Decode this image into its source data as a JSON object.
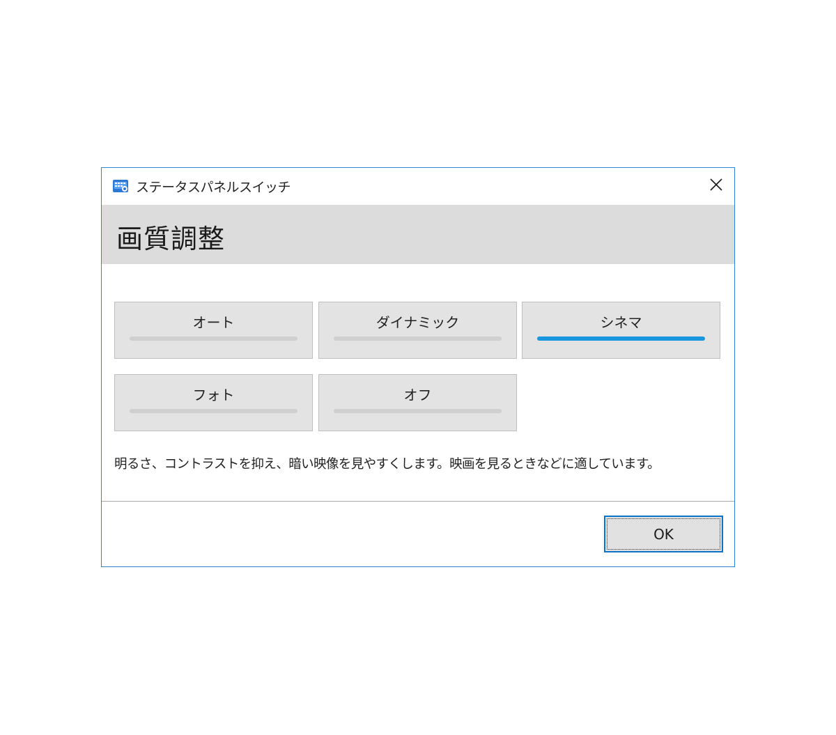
{
  "window": {
    "title": "ステータスパネルスイッチ",
    "icon": "app-icon",
    "close_icon": "close-icon"
  },
  "header": {
    "title": "画質調整"
  },
  "modes": [
    {
      "label": "オート",
      "selected": false
    },
    {
      "label": "ダイナミック",
      "selected": false
    },
    {
      "label": "シネマ",
      "selected": true
    },
    {
      "label": "フォト",
      "selected": false
    },
    {
      "label": "オフ",
      "selected": false
    }
  ],
  "description": "明るさ、コントラストを抑え、暗い映像を見やすくします。映画を見るときなどに適しています。",
  "footer": {
    "ok_label": "OK"
  },
  "colors": {
    "accent": "#1997de",
    "window_border": "#2b87d3",
    "header_band": "#dcdcdc",
    "button_face": "#e3e3e3",
    "inactive_bar": "#cfcfcf",
    "ok_border": "#0a72c7"
  }
}
